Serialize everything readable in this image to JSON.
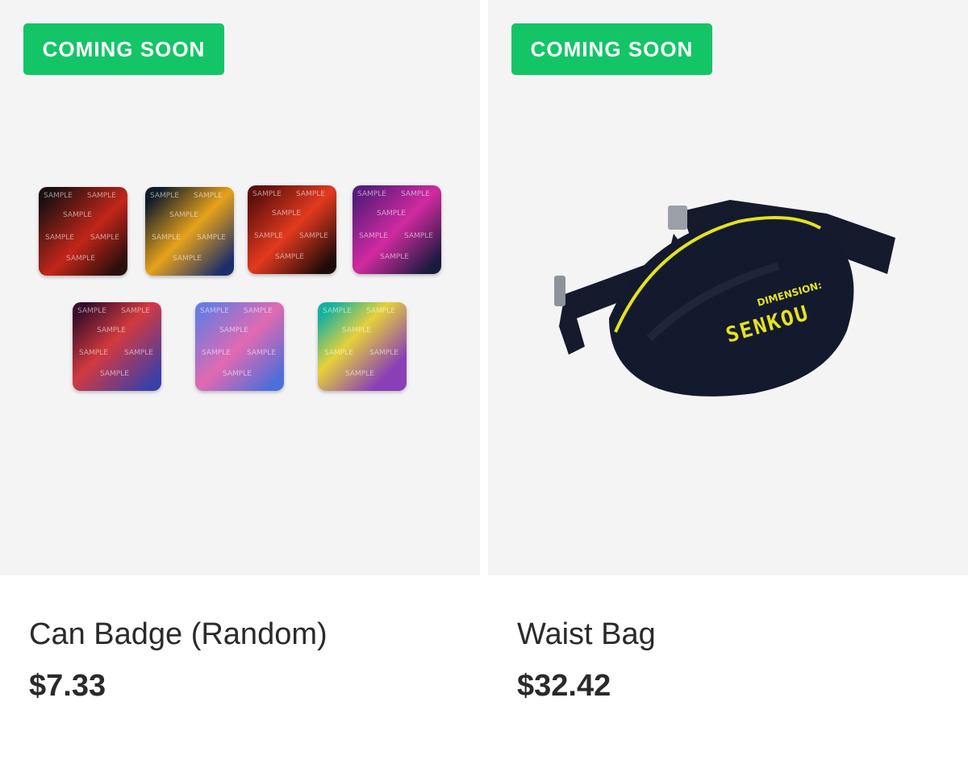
{
  "products": [
    {
      "badge": "COMING SOON",
      "title": "Can Badge (Random)",
      "price": "$7.33",
      "image_alt": "can-badge-set",
      "badge_color": "#13c566",
      "watermark": "SAMPLE"
    },
    {
      "badge": "COMING SOON",
      "title": "Waist Bag",
      "price": "$32.42",
      "image_alt": "waist-bag",
      "badge_color": "#13c566",
      "print_top": "DIMENSION:",
      "print_logo": "SENKOU"
    }
  ]
}
